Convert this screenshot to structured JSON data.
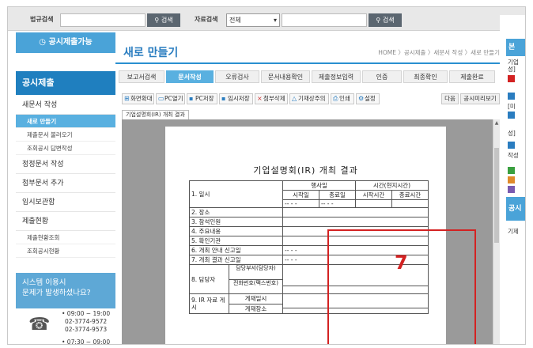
{
  "topbar": {
    "law_search_label": "법규검색",
    "search_btn": "검색",
    "data_search_label": "자료검색",
    "data_search_select": "전체",
    "search_btn2": "검색"
  },
  "sidebar": {
    "submit_possible": "공시제출가능",
    "heading": "공시제출",
    "items": [
      {
        "label": "새문서 작성"
      },
      {
        "label": "새로 만들기"
      },
      {
        "label": "제출문서 불러오기"
      },
      {
        "label": "조회공시 답변작성"
      },
      {
        "label": "정정문서 작성"
      },
      {
        "label": "첨부문서 추가"
      },
      {
        "label": "임시보관함"
      },
      {
        "label": "제출현황"
      },
      {
        "label": "제출현황조회"
      },
      {
        "label": "조회공시현황"
      }
    ],
    "help_line1": "시스템 이용시",
    "help_line2": "문제가 발생하셨나요?",
    "phone_hours": "• 09:00 ~ 19:00",
    "phone1": "02-3774-9572",
    "phone2": "02-3774-9573",
    "phone_hours2": "• 07:30 ~ 09:00"
  },
  "main": {
    "title": "새로 만들기",
    "breadcrumb": "HOME 〉공시제출 〉새문서 작성 〉새로 만들기",
    "steps": [
      "보고서검색",
      "문서작성",
      "오류검사",
      "문서내용확인",
      "제출정보입력",
      "인증",
      "최종확인",
      "제출완료"
    ],
    "tools": [
      "화면확대",
      "PC열기",
      "PC저장",
      "임시저장",
      "첨부삭제",
      "기재상주의",
      "인쇄",
      "설정"
    ],
    "tool_next": "다음",
    "tool_preview": "공시미리보기",
    "doc_tab": "기업설명회(IR) 개최 결과",
    "doc_title": "기업설명회(IR) 개최 결과"
  },
  "table": {
    "h_date": "1. 일시",
    "h_korea": "행사일",
    "h_time": "시간(현지시간)",
    "h_start_date": "시작일",
    "h_end_date": "종료일",
    "h_start_time": "시작시간",
    "h_end_time": "종료시간",
    "date_placeholder": "-- - -",
    "r2": "2. 장소",
    "r3": "3. 참석인원",
    "r4": "4. 주요내용",
    "r5": "5. 확인기관",
    "r6": "6. 개최 안내 신고일",
    "r7": "7. 개최 결과 신고일",
    "r8": "8. 담당자",
    "r8a": "담당부서(담당자)",
    "r8b": "전화번호(팩스번호)",
    "r9": "9. IR 자료 게시",
    "r9a": "게재일시",
    "r9b": "게재장소"
  },
  "annotation": "7",
  "rightcol": {
    "head1": "본",
    "txt1": "기업",
    "txt2": "성]",
    "txt3": "[미",
    "txt4": "성]",
    "txt5": "작성",
    "head2": "공시",
    "txt6": "기제"
  },
  "colors": {
    "accent": "#2a7dc0",
    "highlight": "#d32222",
    "sidebar_active": "#59b0e0"
  }
}
